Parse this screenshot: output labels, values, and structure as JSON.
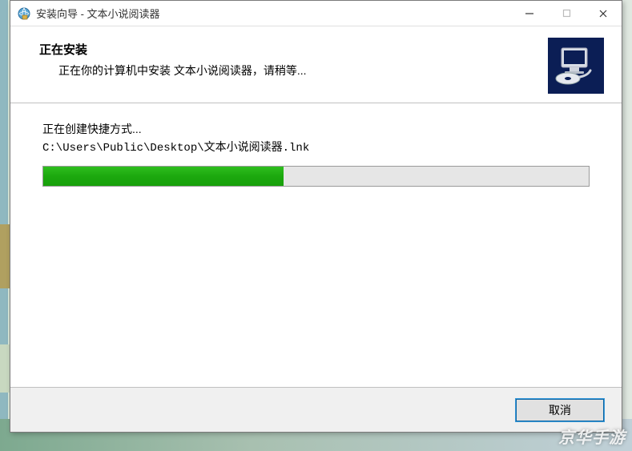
{
  "titlebar": {
    "text": "安装向导 - 文本小说阅读器",
    "minimize": "—",
    "maximize": "☐",
    "close": "✕"
  },
  "header": {
    "title": "正在安装",
    "subtitle": "正在你的计算机中安装 文本小说阅读器，请稍等..."
  },
  "body": {
    "status": "正在创建快捷方式...",
    "path": "C:\\Users\\Public\\Desktop\\文本小说阅读器.lnk",
    "progress_percent": 44
  },
  "footer": {
    "cancel": "取消"
  },
  "watermark": "京华手游",
  "icons": {
    "app": "installer-globe-icon",
    "logo": "computer-disc-icon"
  },
  "colors": {
    "logo_bg": "#0b1e55",
    "progress_fill": "#1ca80e"
  }
}
